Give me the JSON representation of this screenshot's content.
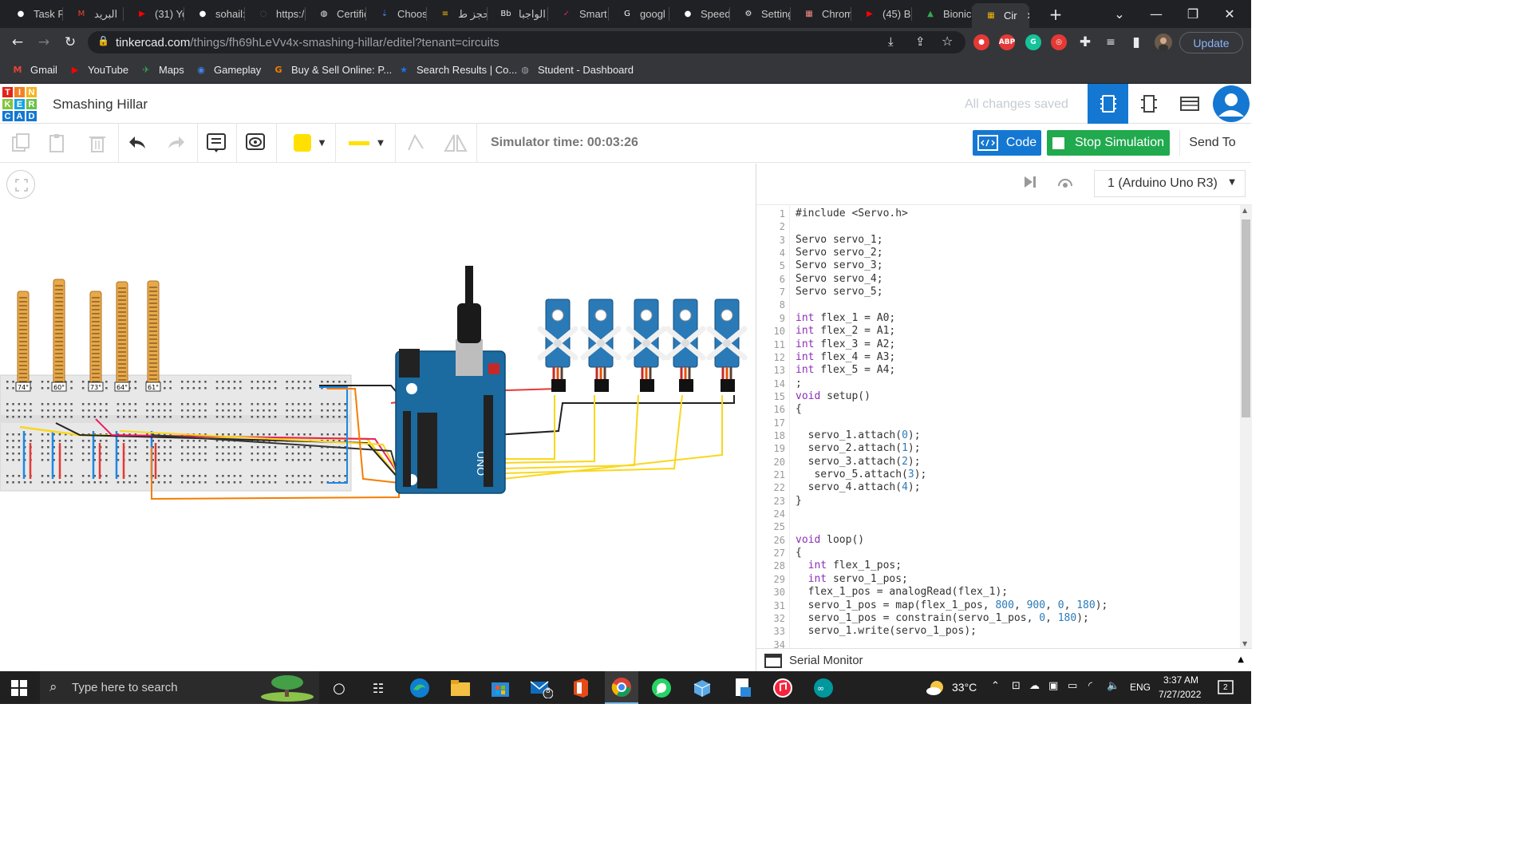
{
  "browser": {
    "tabs": [
      {
        "title": "Task R",
        "icon": "github-icon",
        "color": "#ffffff"
      },
      {
        "title": "البريد",
        "icon": "gmail-icon",
        "color": "#ea4335"
      },
      {
        "title": "(31) Yo",
        "icon": "youtube-icon",
        "color": "#ff0000"
      },
      {
        "title": "sohail:",
        "icon": "github-icon",
        "color": "#ffffff"
      },
      {
        "title": "https:/",
        "icon": "loading-icon",
        "color": "#5f6368"
      },
      {
        "title": "Certific",
        "icon": "globe-icon",
        "color": "#e8eaed"
      },
      {
        "title": "Choos",
        "icon": "download-icon",
        "color": "#4285f4"
      },
      {
        "title": "حجز ط",
        "icon": "bars-icon",
        "color": "#fbbc04"
      },
      {
        "title": "الواجبا",
        "icon": "bb-icon",
        "color": "#e8eaed"
      },
      {
        "title": "Smart",
        "icon": "smart-icon",
        "color": "#e91e63"
      },
      {
        "title": "googl",
        "icon": "google-icon",
        "color": "#ffffff"
      },
      {
        "title": "Speed",
        "icon": "github-icon",
        "color": "#ffffff"
      },
      {
        "title": "Setting",
        "icon": "gear-icon",
        "color": "#e8eaed"
      },
      {
        "title": "Chrom",
        "icon": "store-icon",
        "color": "#f28b82"
      },
      {
        "title": "(45) Bi",
        "icon": "youtube-icon",
        "color": "#ff0000"
      },
      {
        "title": "Bionic",
        "icon": "drive-icon",
        "color": "#34a853"
      },
      {
        "title": "Cir",
        "icon": "tinkercad-icon",
        "color": "#f4b400"
      }
    ],
    "new_tab": "+",
    "url_host": "tinkercad.com",
    "url_path": "/things/fh69hLeVv4x-smashing-hillar/editel?tenant=circuits",
    "update_label": "Update",
    "extensions": [
      {
        "name": "record-ext-icon",
        "label": "●",
        "color": "#e53935"
      },
      {
        "name": "adblock-ext-icon",
        "label": "ABP",
        "color": "#e53935"
      },
      {
        "name": "grammarly-ext-icon",
        "label": "G",
        "color": "#15c39a"
      },
      {
        "name": "ext-red-icon",
        "label": "◎",
        "color": "#e53935"
      }
    ],
    "bookmarks": [
      {
        "label": "Gmail",
        "icon": "gmail-icon",
        "color": "#ea4335"
      },
      {
        "label": "YouTube",
        "icon": "youtube-icon",
        "color": "#ff0000"
      },
      {
        "label": "Maps",
        "icon": "maps-icon",
        "color": "#34a853"
      },
      {
        "label": "Gameplay",
        "icon": "gameplay-icon",
        "color": "#4285f4"
      },
      {
        "label": "Buy & Sell Online: P...",
        "icon": "g-icon",
        "color": "#f57c00"
      },
      {
        "label": "Search Results | Co...",
        "icon": "star-icon",
        "color": "#1a73e8"
      },
      {
        "label": "Student - Dashboard",
        "icon": "globe-icon",
        "color": "#9aa0a6"
      }
    ]
  },
  "tinkercad": {
    "logo_letters": [
      "T",
      "I",
      "N",
      "K",
      "E",
      "R",
      "C",
      "A",
      "D"
    ],
    "logo_colors": [
      "#e2231a",
      "#f48024",
      "#f6b221",
      "#85c440",
      "#1aa3dd",
      "#6cc04a",
      "#1477d2",
      "#1477d2",
      "#1477d2"
    ],
    "project_title": "Smashing Hillar",
    "save_status": "All changes saved",
    "sim_time_label": "Simulator time: 00:03:26",
    "code_label": "Code",
    "stop_label": "Stop Simulation",
    "send_to_label": "Send To",
    "device": "1 (Arduino Uno R3)",
    "serial_monitor": "Serial Monitor",
    "colors": {
      "accent": "#1477d2",
      "green": "#21a94e"
    }
  },
  "canvas": {
    "flex_angles": [
      "74°",
      "60°",
      "73°",
      "64°",
      "61°"
    ],
    "board_label": "UNO"
  },
  "code": {
    "lines": [
      "#include <Servo.h>",
      "",
      "Servo servo_1;",
      "Servo servo_2;",
      "Servo servo_3;",
      "Servo servo_4;",
      "Servo servo_5;",
      "",
      "int flex_1 = A0;",
      "int flex_2 = A1;",
      "int flex_3 = A2;",
      "int flex_4 = A3;",
      "int flex_5 = A4;",
      ";",
      "void setup()",
      "{",
      "",
      "  servo_1.attach(0);",
      "  servo_2.attach(1);",
      "  servo_3.attach(2);",
      "   servo_5.attach(3);",
      "  servo_4.attach(4);",
      "}",
      "",
      "",
      "void loop()",
      "{",
      "  int flex_1_pos;",
      "  int servo_1_pos;",
      "  flex_1_pos = analogRead(flex_1);",
      "  servo_1_pos = map(flex_1_pos, 800, 900, 0, 180);",
      "  servo_1_pos = constrain(servo_1_pos, 0, 180);",
      "  servo_1.write(servo_1_pos);",
      ""
    ]
  },
  "taskbar": {
    "search_placeholder": "Type here to search",
    "temperature": "33°C",
    "language": "ENG",
    "time": "3:37 AM",
    "date": "7/27/2022",
    "notification_count": "2",
    "mail_badge": "8"
  }
}
